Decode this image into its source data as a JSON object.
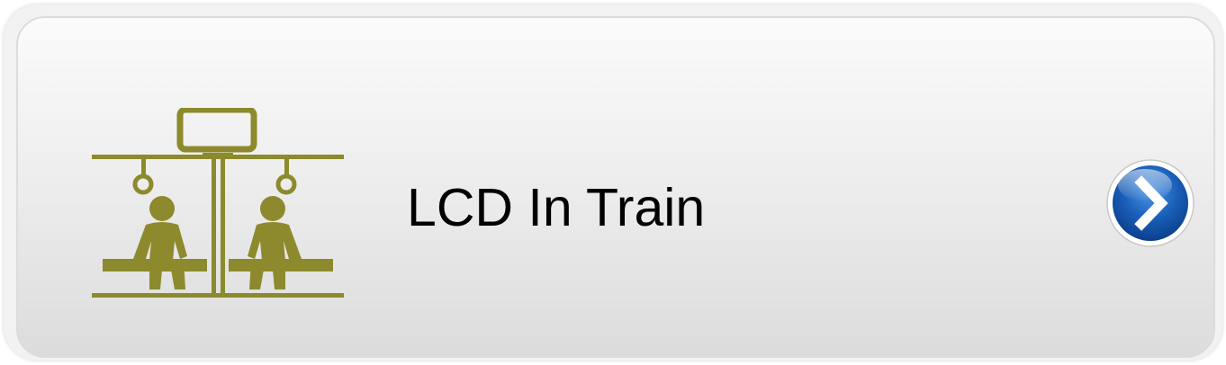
{
  "item": {
    "label": "LCD In Train",
    "icon": "train-lcd-passengers-icon",
    "action_icon": "chevron-right-circle-icon"
  },
  "colors": {
    "icon_olive": "#8c8a2c",
    "arrow_blue": "#1a5fb8",
    "card_top": "#fbfbfb",
    "card_bottom": "#dcdcdc",
    "text": "#000000"
  }
}
